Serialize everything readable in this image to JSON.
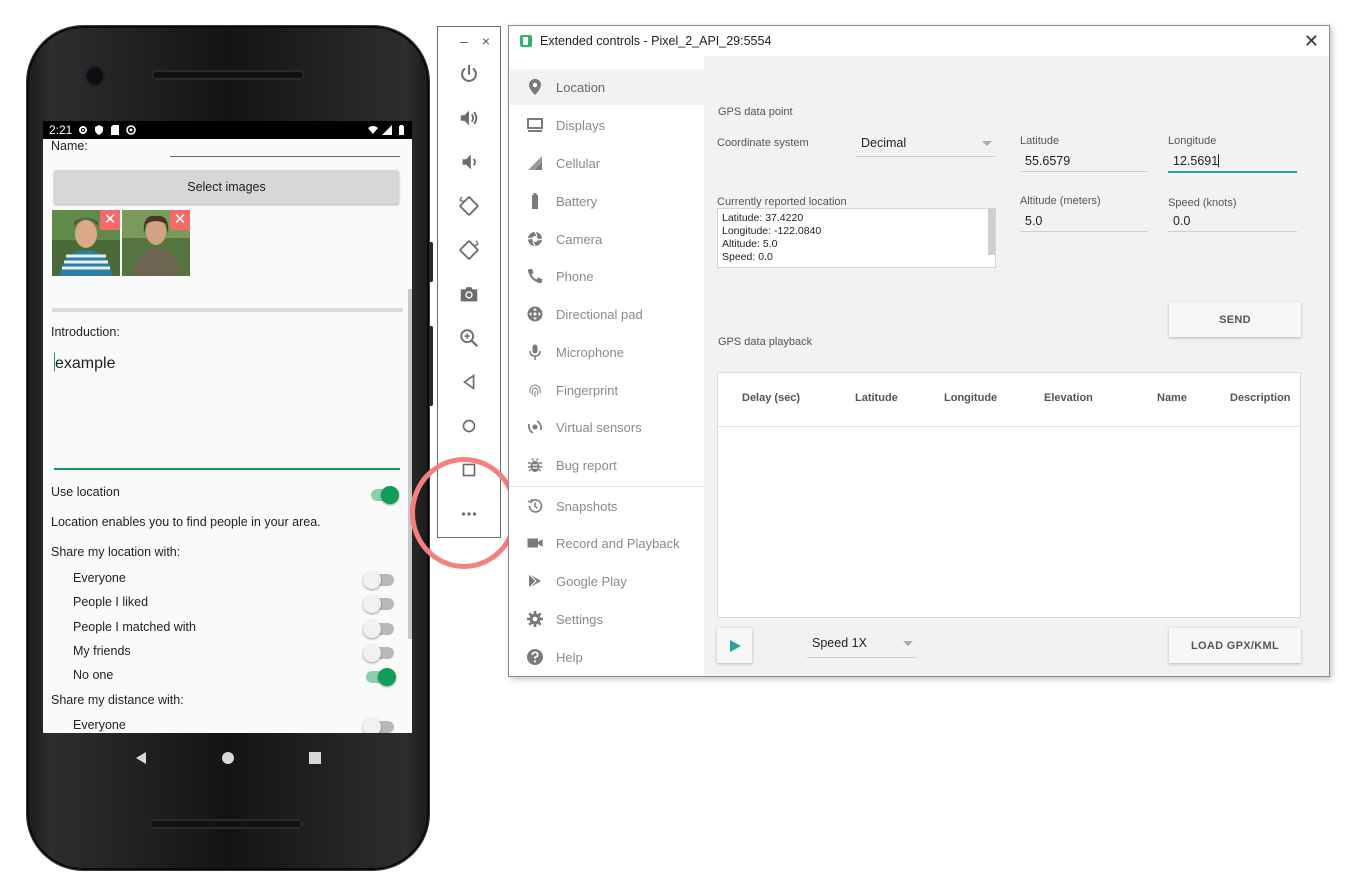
{
  "phone": {
    "status": {
      "time": "2:21"
    },
    "form": {
      "name_label": "Name:",
      "select_images_label": "Select images",
      "delete_symbol": "✕",
      "introduction_label": "Introduction:",
      "introduction_value": "example",
      "use_location_label": "Use location",
      "use_location_on": true,
      "location_hint": "Location enables you to find people in your area.",
      "share_location_label": "Share my location with:",
      "share_location_options": [
        {
          "label": "Everyone",
          "on": false
        },
        {
          "label": "People I liked",
          "on": false
        },
        {
          "label": "People I matched with",
          "on": false
        },
        {
          "label": "My friends",
          "on": false
        },
        {
          "label": "No one",
          "on": true
        }
      ],
      "share_distance_label": "Share my distance with:",
      "share_distance_options": [
        {
          "label": "Everyone",
          "on": false
        }
      ]
    },
    "accent_color": "#0f9d58"
  },
  "toolbar": {
    "minimize": "–",
    "close": "×",
    "items": [
      "power-icon",
      "volume-up-icon",
      "volume-down-icon",
      "rotate-left-icon",
      "rotate-right-icon",
      "camera-icon",
      "zoom-icon",
      "back-icon",
      "home-icon",
      "overview-icon",
      "more-icon"
    ],
    "highlight_color": "#f2817f"
  },
  "window": {
    "title": "Extended controls - Pixel_2_API_29:5554",
    "close": "✕",
    "nav": [
      {
        "label": "Location",
        "icon": "location-pin-icon",
        "active": true
      },
      {
        "label": "Displays",
        "icon": "display-icon"
      },
      {
        "label": "Cellular",
        "icon": "cellular-icon"
      },
      {
        "label": "Battery",
        "icon": "battery-icon"
      },
      {
        "label": "Camera",
        "icon": "camera-aperture-icon"
      },
      {
        "label": "Phone",
        "icon": "phone-icon"
      },
      {
        "label": "Directional pad",
        "icon": "dpad-icon"
      },
      {
        "label": "Microphone",
        "icon": "microphone-icon"
      },
      {
        "label": "Fingerprint",
        "icon": "fingerprint-icon"
      },
      {
        "label": "Virtual sensors",
        "icon": "sensors-icon"
      },
      {
        "label": "Bug report",
        "icon": "bug-icon"
      },
      {
        "label": "Snapshots",
        "icon": "history-icon"
      },
      {
        "label": "Record and Playback",
        "icon": "video-icon"
      },
      {
        "label": "Google Play",
        "icon": "play-store-icon"
      },
      {
        "label": "Settings",
        "icon": "gear-icon"
      },
      {
        "label": "Help",
        "icon": "help-icon"
      }
    ],
    "gps_point": {
      "section_title": "GPS data point",
      "coord_system_label": "Coordinate system",
      "coord_system_value": "Decimal",
      "latitude_label": "Latitude",
      "latitude_value": "55.6579",
      "longitude_label": "Longitude",
      "longitude_value": "12.5691",
      "altitude_label": "Altitude (meters)",
      "altitude_value": "5.0",
      "speed_label": "Speed (knots)",
      "speed_value": "0.0",
      "reported_label": "Currently reported location",
      "reported_lines": [
        "Latitude: 37.4220",
        "Longitude: -122.0840",
        "Altitude: 5.0",
        "Speed: 0.0"
      ],
      "send_label": "SEND"
    },
    "playback": {
      "section_title": "GPS data playback",
      "columns": [
        "Delay (sec)",
        "Latitude",
        "Longitude",
        "Elevation",
        "Name",
        "Description"
      ],
      "speed_value": "Speed 1X",
      "load_label": "LOAD GPX/KML"
    },
    "accent_color": "#26a69a"
  }
}
